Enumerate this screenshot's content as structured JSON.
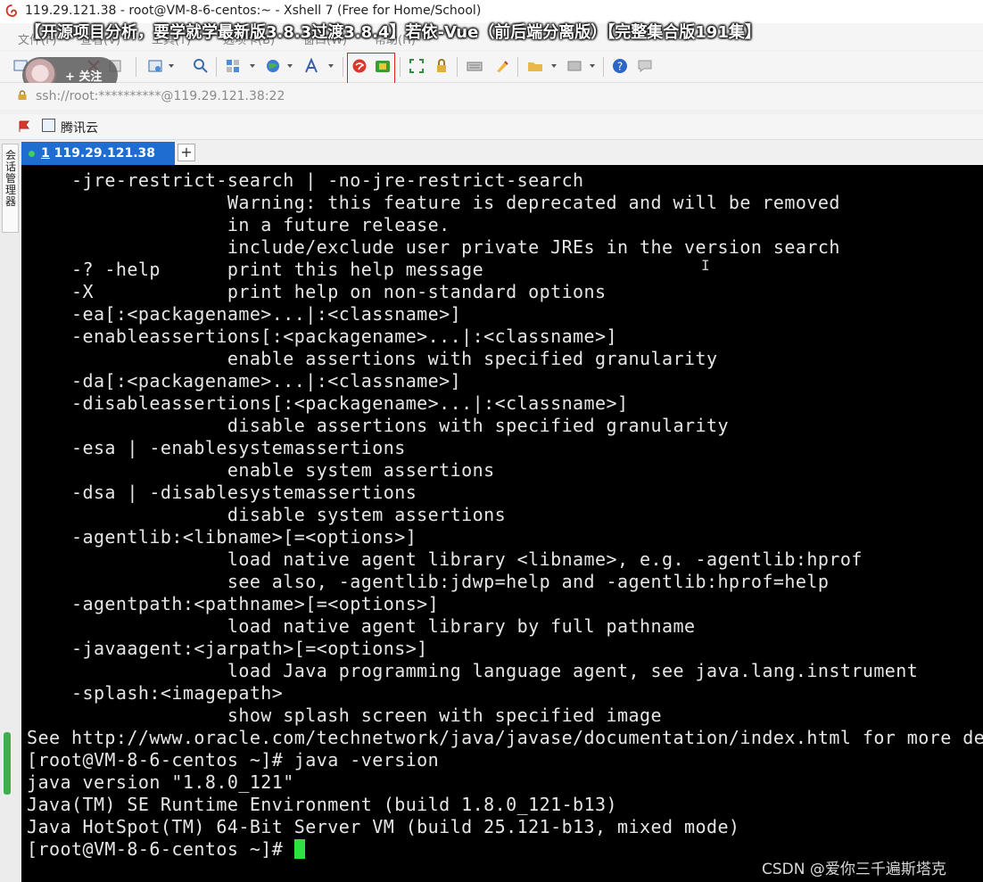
{
  "window": {
    "title": "119.29.121.38 - root@VM-8-6-centos:~ - Xshell 7 (Free for Home/School)",
    "app_icon": "xshell-logo-icon"
  },
  "overlay": {
    "title": "【开源项目分析，要学就学最新版3.8.3过渡3.8.4】若依-Vue（前后端分离版）【完整集合版191集】",
    "follow_label": "+ 关注"
  },
  "menu": {
    "items": [
      "文件(F)",
      "查看(V)",
      "工具(T)",
      "选项卡(B)",
      "窗口(W)",
      "帮助(H)"
    ]
  },
  "toolbar": {
    "icons": [
      "new-session-icon",
      "open-folder-icon",
      "disconnect-icon",
      "reconnect-icon",
      "properties-icon",
      "find-icon",
      "layout-icon",
      "globe-icon",
      "font-icon",
      "xftp-icon",
      "xshell-new-icon",
      "fullscreen-icon",
      "lock-icon",
      "keyboard-icon",
      "highlight-icon",
      "folder-add-icon",
      "options-icon",
      "help-icon",
      "chat-icon"
    ]
  },
  "address": {
    "value": "ssh://root:**********@119.29.121.38:22"
  },
  "links": {
    "item": "腾讯云"
  },
  "side_panel": {
    "label": "会话管理器"
  },
  "tabs": {
    "active": {
      "number": "1",
      "host": "119.29.121.38"
    },
    "add_label": "+"
  },
  "terminal": {
    "lines": [
      "    -jre-restrict-search | -no-jre-restrict-search",
      "                  Warning: this feature is deprecated and will be removed",
      "                  in a future release.",
      "                  include/exclude user private JREs in the version search",
      "    -? -help      print this help message",
      "    -X            print help on non-standard options",
      "    -ea[:<packagename>...|:<classname>]",
      "    -enableassertions[:<packagename>...|:<classname>]",
      "                  enable assertions with specified granularity",
      "    -da[:<packagename>...|:<classname>]",
      "    -disableassertions[:<packagename>...|:<classname>]",
      "                  disable assertions with specified granularity",
      "    -esa | -enablesystemassertions",
      "                  enable system assertions",
      "    -dsa | -disablesystemassertions",
      "                  disable system assertions",
      "    -agentlib:<libname>[=<options>]",
      "                  load native agent library <libname>, e.g. -agentlib:hprof",
      "                  see also, -agentlib:jdwp=help and -agentlib:hprof=help",
      "    -agentpath:<pathname>[=<options>]",
      "                  load native agent library by full pathname",
      "    -javaagent:<jarpath>[=<options>]",
      "                  load Java programming language agent, see java.lang.instrument",
      "    -splash:<imagepath>",
      "                  show splash screen with specified image",
      "See http://www.oracle.com/technetwork/java/javase/documentation/index.html for more details.",
      "[root@VM-8-6-centos ~]# java -version",
      "java version \"1.8.0_121\"",
      "Java(TM) SE Runtime Environment (build 1.8.0_121-b13)",
      "Java HotSpot(TM) 64-Bit Server VM (build 25.121-b13, mixed mode)"
    ],
    "prompt": "[root@VM-8-6-centos ~]# "
  },
  "watermark": "CSDN @爱你三千遍斯塔克",
  "colors": {
    "tab_active": "#1f6dd0",
    "cursor": "#2ee040",
    "terminal_bg": "#000000",
    "highlight_box": "#e02020"
  }
}
